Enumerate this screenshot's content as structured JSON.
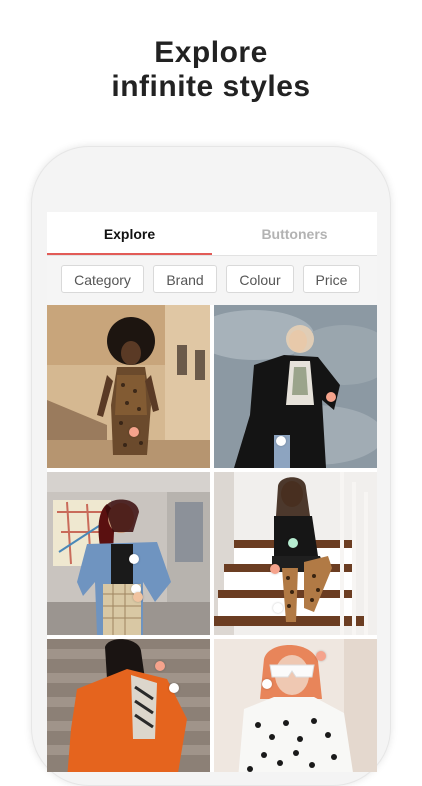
{
  "headline": {
    "line1": "Explore",
    "line2": "infinite styles"
  },
  "tabs": [
    {
      "label": "Explore",
      "active": true
    },
    {
      "label": "Buttoners",
      "active": false
    }
  ],
  "filters": [
    {
      "label": "Category"
    },
    {
      "label": "Brand"
    },
    {
      "label": "Colour"
    },
    {
      "label": "Price"
    }
  ],
  "colors": {
    "accent": "#e25b57",
    "headline_text": "#222222",
    "inactive_tab": "#b3b3b3"
  },
  "grid": {
    "photos": [
      {
        "subject": "woman in leopard dress outdoors"
      },
      {
        "subject": "woman in black blazer against sky"
      },
      {
        "subject": "woman in denim jacket on subway"
      },
      {
        "subject": "woman in leopard boots on stairs"
      },
      {
        "subject": "woman in orange coat on steps"
      },
      {
        "subject": "woman with sunglasses in spotted top"
      }
    ]
  }
}
